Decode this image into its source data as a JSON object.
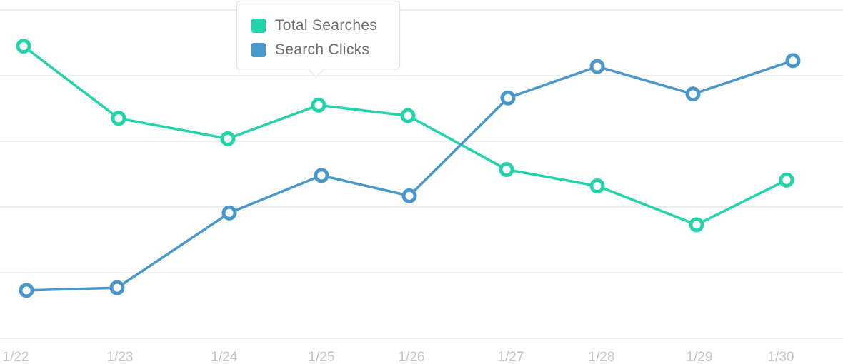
{
  "chart_data": {
    "type": "line",
    "title": "",
    "xlabel": "",
    "ylabel": "",
    "grid": true,
    "ylim": [
      0,
      5
    ],
    "x": [
      "1/22",
      "1/23",
      "1/24",
      "1/25",
      "1/26",
      "1/27",
      "1/28",
      "1/29",
      "1/30"
    ],
    "series": [
      {
        "name": "Total Searches",
        "color": "#25d3ab",
        "values": [
          4.45,
          3.35,
          3.04,
          3.55,
          3.39,
          2.57,
          2.32,
          1.73,
          2.41
        ]
      },
      {
        "name": "Search Clicks",
        "color": "#4a97c9",
        "values": [
          0.73,
          0.77,
          1.91,
          2.48,
          2.17,
          3.66,
          4.14,
          3.72,
          4.23
        ]
      }
    ],
    "legend": {
      "placement": "top-center",
      "style": "tooltip"
    }
  }
}
